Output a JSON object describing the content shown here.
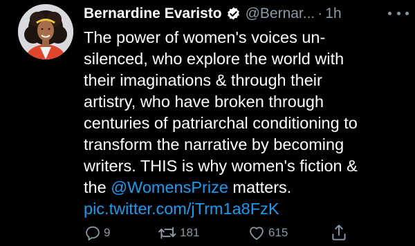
{
  "author": {
    "name": "Bernardine Evaristo",
    "handle": "@Bernar...",
    "separator": "·",
    "time": "1h",
    "avatar_icon": "profile-photo",
    "verified_icon": "verified-badge-icon"
  },
  "tweet": {
    "lines": [
      "The power of women's voices un-",
      "silenced, who explore the world with",
      "their imaginations & through their",
      "artistry, who have broken through",
      "centuries of patriarchal conditioning to",
      "transform the narrative by becoming",
      "writers. THIS is why women's fiction &"
    ],
    "line8_prefix": "the ",
    "mention": "@WomensPrize",
    "line8_suffix": " matters.",
    "link": "pic.twitter.com/jTrm1a8FzK"
  },
  "actions": {
    "reply_count": "9",
    "retweet_count": "181",
    "like_count": "615"
  },
  "colors": {
    "background": "#000000",
    "text": "#ffffff",
    "secondary": "#8b98a5",
    "link": "#1d9bf0"
  }
}
